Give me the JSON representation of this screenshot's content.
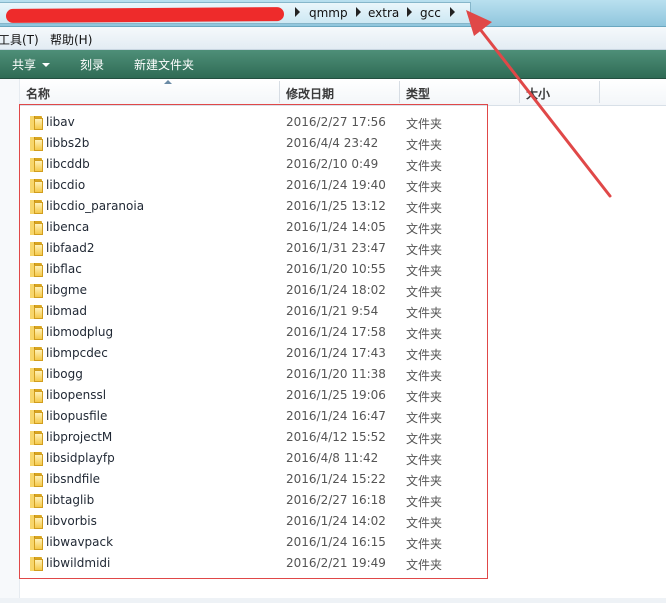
{
  "address": {
    "crumbs": [
      "qmmp",
      "extra",
      "gcc"
    ]
  },
  "menu": [
    "工具(T)",
    "帮助(H)"
  ],
  "toolbar": {
    "share": "共享",
    "burn": "刻录",
    "new_folder": "新建文件夹"
  },
  "columns": {
    "name": "名称",
    "modified": "修改日期",
    "type": "类型",
    "size": "大小"
  },
  "files": [
    {
      "name": "libav",
      "date": "2016/2/27 17:56",
      "type": "文件夹"
    },
    {
      "name": "libbs2b",
      "date": "2016/4/4 23:42",
      "type": "文件夹"
    },
    {
      "name": "libcddb",
      "date": "2016/2/10 0:49",
      "type": "文件夹"
    },
    {
      "name": "libcdio",
      "date": "2016/1/24 19:40",
      "type": "文件夹"
    },
    {
      "name": "libcdio_paranoia",
      "date": "2016/1/25 13:12",
      "type": "文件夹"
    },
    {
      "name": "libenca",
      "date": "2016/1/24 14:05",
      "type": "文件夹"
    },
    {
      "name": "libfaad2",
      "date": "2016/1/31 23:47",
      "type": "文件夹"
    },
    {
      "name": "libflac",
      "date": "2016/1/20 10:55",
      "type": "文件夹"
    },
    {
      "name": "libgme",
      "date": "2016/1/24 18:02",
      "type": "文件夹"
    },
    {
      "name": "libmad",
      "date": "2016/1/21 9:54",
      "type": "文件夹"
    },
    {
      "name": "libmodplug",
      "date": "2016/1/24 17:58",
      "type": "文件夹"
    },
    {
      "name": "libmpcdec",
      "date": "2016/1/24 17:43",
      "type": "文件夹"
    },
    {
      "name": "libogg",
      "date": "2016/1/20 11:38",
      "type": "文件夹"
    },
    {
      "name": "libopenssl",
      "date": "2016/1/25 19:06",
      "type": "文件夹"
    },
    {
      "name": "libopusfile",
      "date": "2016/1/24 16:47",
      "type": "文件夹"
    },
    {
      "name": "libprojectM",
      "date": "2016/4/12 15:52",
      "type": "文件夹"
    },
    {
      "name": "libsidplayfp",
      "date": "2016/4/8 11:42",
      "type": "文件夹"
    },
    {
      "name": "libsndfile",
      "date": "2016/1/24 15:22",
      "type": "文件夹"
    },
    {
      "name": "libtaglib",
      "date": "2016/2/27 16:18",
      "type": "文件夹"
    },
    {
      "name": "libvorbis",
      "date": "2016/1/24 14:02",
      "type": "文件夹"
    },
    {
      "name": "libwavpack",
      "date": "2016/1/24 16:15",
      "type": "文件夹"
    },
    {
      "name": "libwildmidi",
      "date": "2016/2/21 19:49",
      "type": "文件夹"
    }
  ],
  "colors": {
    "toolbar": "#3b7a63",
    "annotation": "#e04848",
    "redaction": "#ee2b2b"
  }
}
